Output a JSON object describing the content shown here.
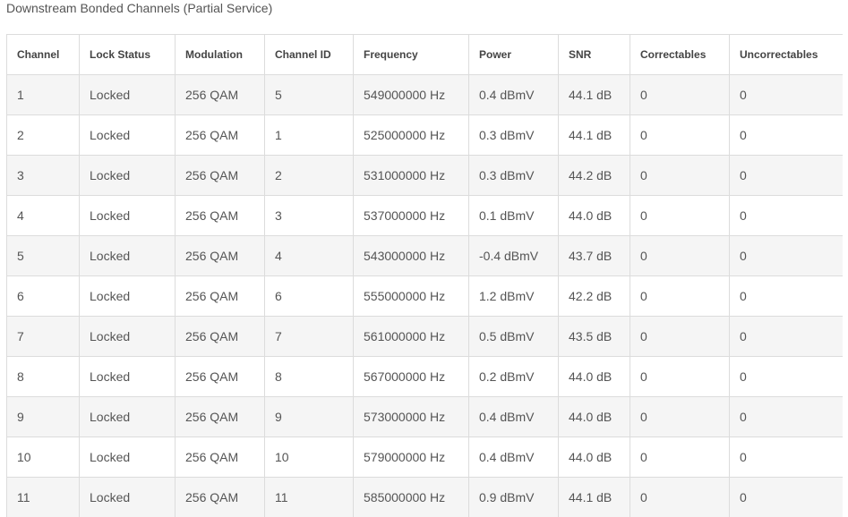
{
  "caption": "Downstream Bonded Channels (Partial Service)",
  "columns": [
    "Channel",
    "Lock Status",
    "Modulation",
    "Channel ID",
    "Frequency",
    "Power",
    "SNR",
    "Correctables",
    "Uncorrectables"
  ],
  "rows": [
    [
      "1",
      "Locked",
      "256 QAM",
      "5",
      "549000000 Hz",
      "0.4 dBmV",
      "44.1 dB",
      "0",
      "0"
    ],
    [
      "2",
      "Locked",
      "256 QAM",
      "1",
      "525000000 Hz",
      "0.3 dBmV",
      "44.1 dB",
      "0",
      "0"
    ],
    [
      "3",
      "Locked",
      "256 QAM",
      "2",
      "531000000 Hz",
      "0.3 dBmV",
      "44.2 dB",
      "0",
      "0"
    ],
    [
      "4",
      "Locked",
      "256 QAM",
      "3",
      "537000000 Hz",
      "0.1 dBmV",
      "44.0 dB",
      "0",
      "0"
    ],
    [
      "5",
      "Locked",
      "256 QAM",
      "4",
      "543000000 Hz",
      "-0.4 dBmV",
      "43.7 dB",
      "0",
      "0"
    ],
    [
      "6",
      "Locked",
      "256 QAM",
      "6",
      "555000000 Hz",
      "1.2 dBmV",
      "42.2 dB",
      "0",
      "0"
    ],
    [
      "7",
      "Locked",
      "256 QAM",
      "7",
      "561000000 Hz",
      "0.5 dBmV",
      "43.5 dB",
      "0",
      "0"
    ],
    [
      "8",
      "Locked",
      "256 QAM",
      "8",
      "567000000 Hz",
      "0.2 dBmV",
      "44.0 dB",
      "0",
      "0"
    ],
    [
      "9",
      "Locked",
      "256 QAM",
      "9",
      "573000000 Hz",
      "0.4 dBmV",
      "44.0 dB",
      "0",
      "0"
    ],
    [
      "10",
      "Locked",
      "256 QAM",
      "10",
      "579000000 Hz",
      "0.4 dBmV",
      "44.0 dB",
      "0",
      "0"
    ],
    [
      "11",
      "Locked",
      "256 QAM",
      "11",
      "585000000 Hz",
      "0.9 dBmV",
      "44.1 dB",
      "0",
      "0"
    ]
  ]
}
